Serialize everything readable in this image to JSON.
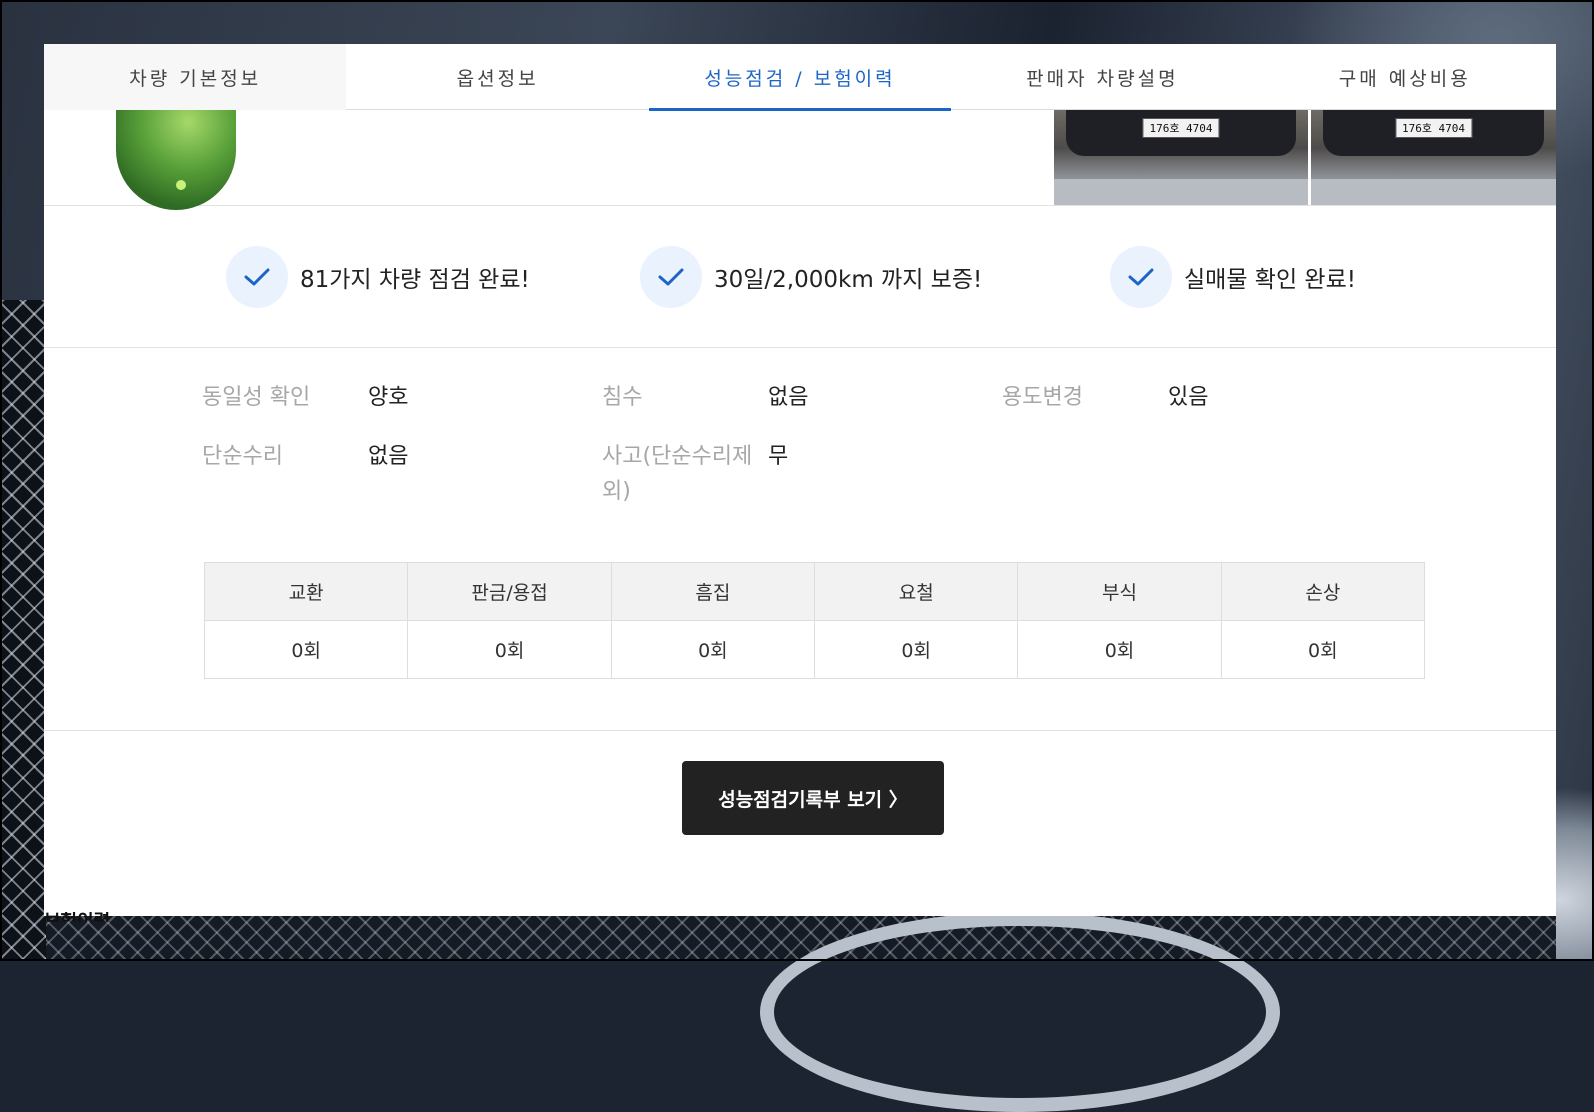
{
  "tabs": [
    {
      "label": "차량 기본정보"
    },
    {
      "label": "옵션정보"
    },
    {
      "label": "성능점검 / 보험이력"
    },
    {
      "label": "판매자 차량설명"
    },
    {
      "label": "구매 예상비용"
    }
  ],
  "photos": {
    "plate_1": "176호 4704",
    "plate_2": "176호 4704"
  },
  "guarantees": [
    {
      "text": "81가지 차량 점검 완료!",
      "icon": "check-icon"
    },
    {
      "text": "30일/2,000km 까지 보증!",
      "icon": "check-icon"
    },
    {
      "text": "실매물 확인 완료!",
      "icon": "check-icon"
    }
  ],
  "inspection": {
    "identity_label": "동일성 확인",
    "identity_value": "양호",
    "flood_label": "침수",
    "flood_value": "없음",
    "usage_label": "용도변경",
    "usage_value": "있음",
    "simple_repair_label": "단순수리",
    "simple_repair_value": "없음",
    "accident_label": "사고(단순수리제외)",
    "accident_value": "무"
  },
  "history_table": {
    "headers": [
      "교환",
      "판금/용접",
      "흠집",
      "요철",
      "부식",
      "손상"
    ],
    "values": [
      "0회",
      "0회",
      "0회",
      "0회",
      "0회",
      "0회"
    ]
  },
  "report_button": {
    "label": "성능점검기록부 보기 〉"
  },
  "colors": {
    "accent": "#1d64c7",
    "check_bg": "#eaf2fd",
    "button_bg": "#222222"
  },
  "below_panel_text": "보험이력"
}
